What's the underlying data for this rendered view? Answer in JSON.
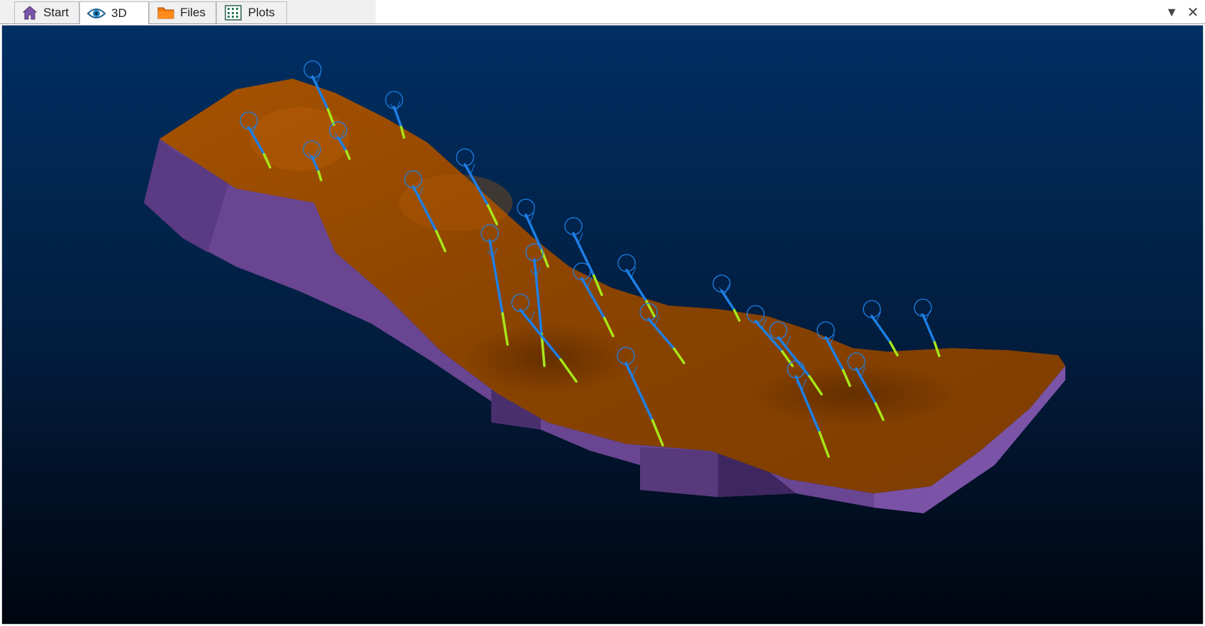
{
  "tabs": [
    {
      "label": "Start",
      "icon": "home-icon",
      "active": false
    },
    {
      "label": "3D",
      "icon": "eye-icon",
      "active": true
    },
    {
      "label": "Files",
      "icon": "folder-icon",
      "active": false
    },
    {
      "label": "Plots",
      "icon": "plot-grid-icon",
      "active": false
    }
  ],
  "window_buttons": {
    "dropdown": "▼",
    "close": "✕"
  },
  "scene": {
    "background_top": "#002f63",
    "background_bottom": "#00050f",
    "surface_color": "#9a4a00",
    "side_color": "#6e4a96",
    "drillhole_color": "#1e7fe6",
    "interval_color": "#a8e617"
  }
}
